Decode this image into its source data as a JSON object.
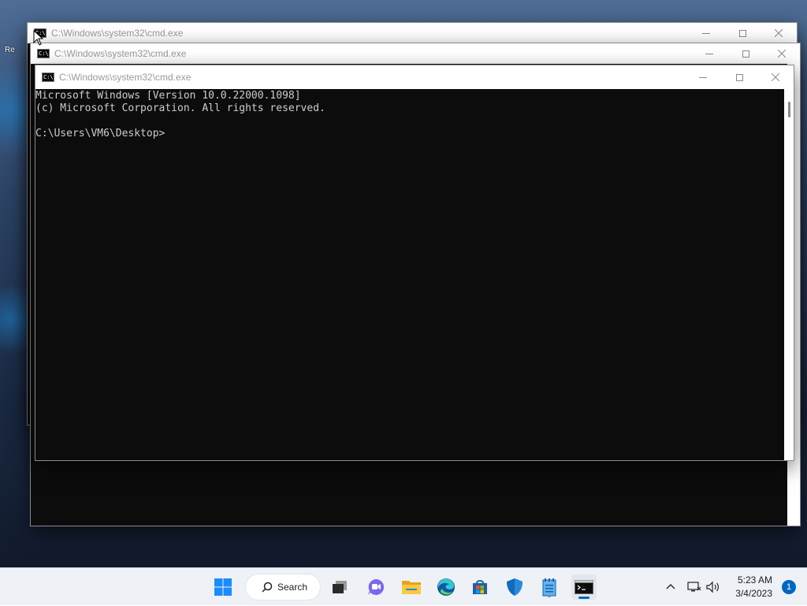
{
  "desktop": {
    "partial_label": "Re"
  },
  "windows": [
    {
      "title": "C:\\Windows\\system32\\cmd.exe",
      "icon_text": "C:\\",
      "icon": "cmd-icon"
    },
    {
      "title": "C:\\Windows\\system32\\cmd.exe",
      "icon_text": "C:\\",
      "icon": "cmd-icon"
    },
    {
      "title": "C:\\Windows\\system32\\cmd.exe",
      "icon_text": "C:\\",
      "icon": "cmd-icon"
    }
  ],
  "console": {
    "lines": [
      "Microsoft Windows [Version 10.0.22000.1098]",
      "(c) Microsoft Corporation. All rights reserved.",
      "",
      "C:\\Users\\VM6\\Desktop>"
    ]
  },
  "taskbar": {
    "search_label": "Search",
    "apps": [
      {
        "name": "start",
        "icon": "windows-logo-icon"
      },
      {
        "name": "search",
        "icon": "search-icon"
      },
      {
        "name": "task-view",
        "icon": "task-view-icon"
      },
      {
        "name": "chat",
        "icon": "teams-chat-icon"
      },
      {
        "name": "file-explorer",
        "icon": "folder-icon"
      },
      {
        "name": "edge",
        "icon": "edge-icon"
      },
      {
        "name": "store",
        "icon": "store-icon"
      },
      {
        "name": "security",
        "icon": "shield-icon"
      },
      {
        "name": "notepad",
        "icon": "notepad-icon"
      },
      {
        "name": "terminal",
        "icon": "cmd-icon"
      }
    ],
    "clock": {
      "time": "5:23 AM",
      "date": "3/4/2023"
    },
    "notification_count": "1",
    "accent_color": "#0067c0"
  }
}
